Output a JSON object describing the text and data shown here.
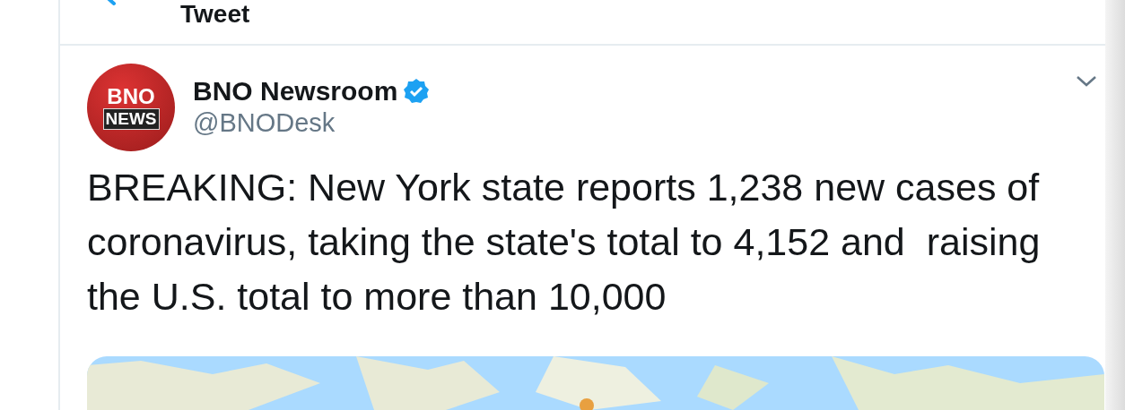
{
  "header": {
    "title": "Tweet"
  },
  "tweet": {
    "avatar": {
      "top": "BNO",
      "bottom": "NEWS"
    },
    "name": "BNO Newsroom",
    "verified": true,
    "handle": "@BNODesk",
    "text": "BREAKING: New York state reports 1,238 new cases of coronavirus, taking the state's total to 4,152 and  raising the U.S. total to more than 10,000"
  }
}
